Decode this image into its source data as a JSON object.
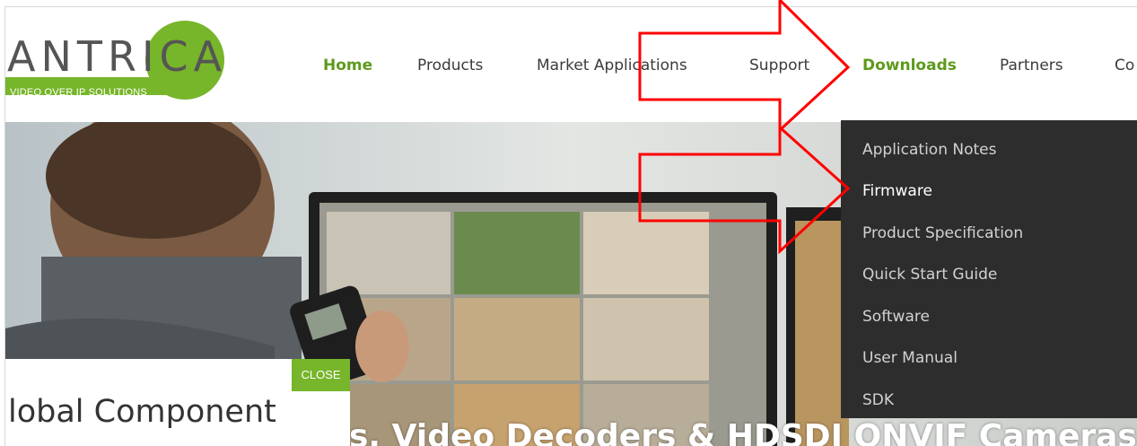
{
  "logo": {
    "name": "ANTRICA",
    "tagline": "VIDEO OVER IP SOLUTIONS",
    "brand_color": "#77b52a"
  },
  "nav": {
    "items": [
      {
        "label": "Home",
        "active": true
      },
      {
        "label": "Products",
        "active": false
      },
      {
        "label": "Market Applications",
        "active": false
      },
      {
        "label": "Support",
        "active": false
      },
      {
        "label": "Downloads",
        "active": true
      },
      {
        "label": "Partners",
        "active": false
      },
      {
        "label": "Co",
        "active": false
      }
    ]
  },
  "dropdown": {
    "items": [
      {
        "label": "Application Notes"
      },
      {
        "label": "Firmware"
      },
      {
        "label": "Product Specification"
      },
      {
        "label": "Quick Start Guide"
      },
      {
        "label": "Software"
      },
      {
        "label": "User Manual"
      },
      {
        "label": "SDK"
      }
    ]
  },
  "hero": {
    "title": "s, Video Decoders & HDSDI ONVIF Cameras"
  },
  "popup": {
    "close_label": "CLOSE",
    "text": "lobal Component"
  },
  "colors": {
    "accent_green": "#5e9a1c",
    "dropdown_bg": "#2d2d2d",
    "annotation_red": "#ff0000"
  }
}
